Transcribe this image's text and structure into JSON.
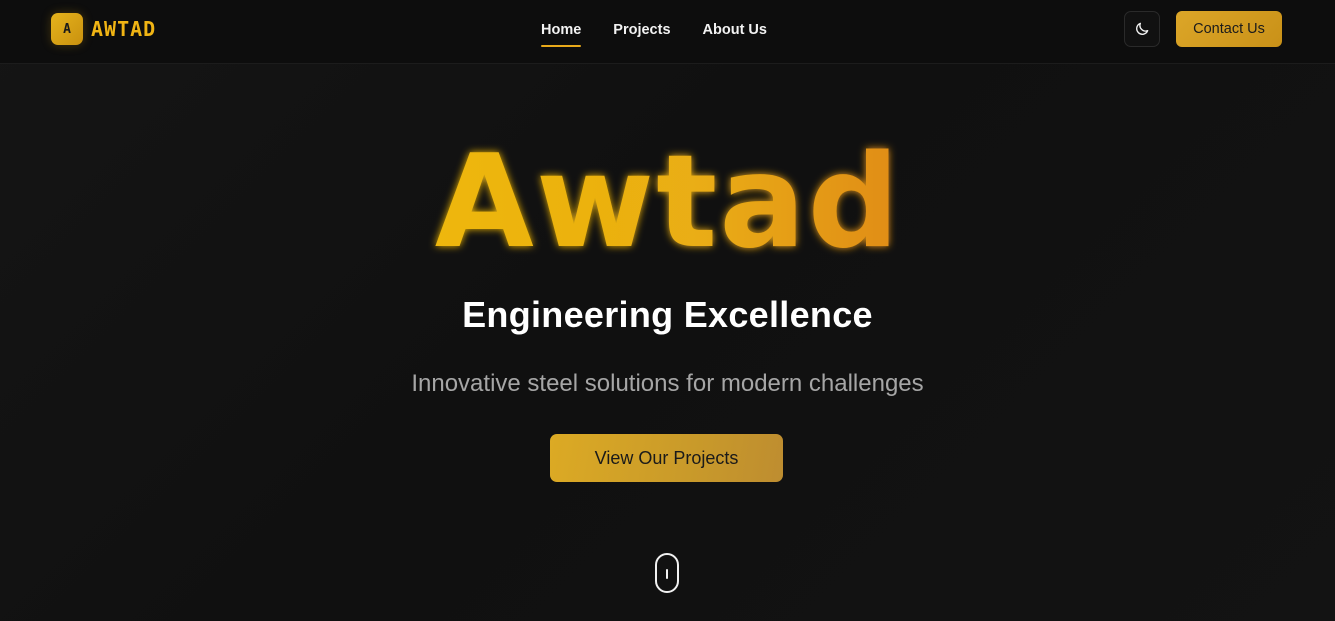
{
  "header": {
    "logo_badge_letter": "A",
    "logo_text": "AWTAD",
    "nav": [
      {
        "label": "Home",
        "active": true
      },
      {
        "label": "Projects",
        "active": false
      },
      {
        "label": "About Us",
        "active": false
      }
    ],
    "theme_toggle_icon": "moon-icon",
    "contact_label": "Contact Us"
  },
  "hero": {
    "title": "Awtad",
    "tagline": "Engineering Excellence",
    "subtitle": "Innovative steel solutions for modern challenges",
    "cta_label": "View Our Projects",
    "scroll_icon": "mouse-scroll-icon"
  },
  "colors": {
    "background": "#121212",
    "accent": "#e8a91a",
    "accent_light": "#f0b414",
    "text_primary": "#ffffff",
    "text_muted": "#a6a6a6"
  }
}
